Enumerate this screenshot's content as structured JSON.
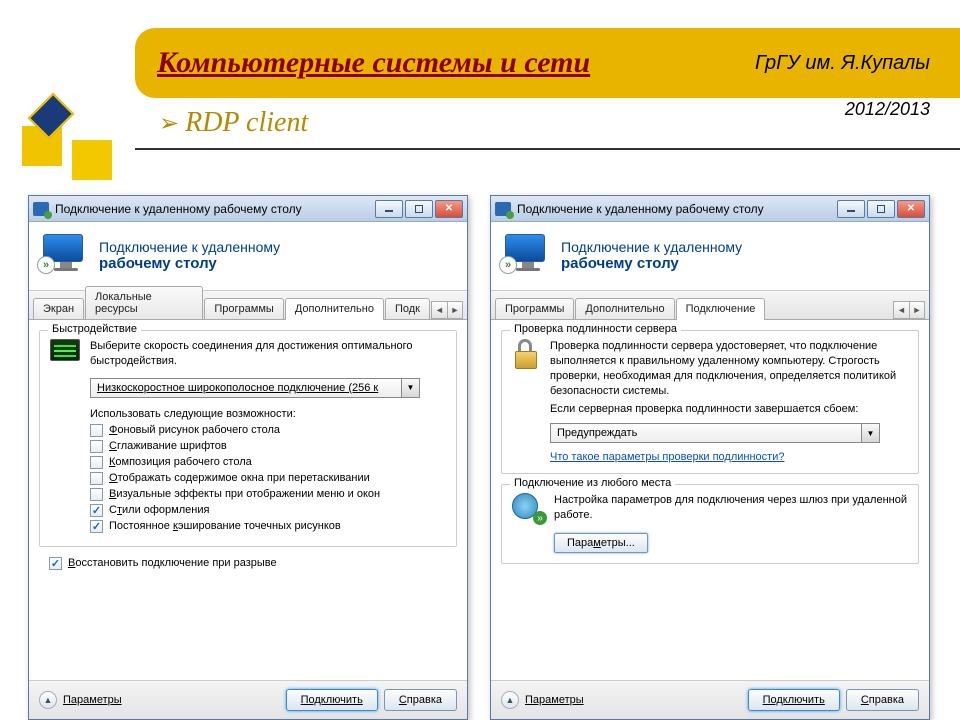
{
  "slide": {
    "title": "Компьютерные системы и сети",
    "subtitle": "RDP client",
    "university": "ГрГУ им. Я.Купалы",
    "year": "2012/2013"
  },
  "window": {
    "title": "Подключение к удаленному рабочему столу",
    "header_line1": "Подключение к удаленному",
    "header_line2": "рабочему столу"
  },
  "left": {
    "tabs": [
      "Экран",
      "Локальные ресурсы",
      "Программы",
      "Дополнительно",
      "Подк"
    ],
    "active_tab": 3,
    "group_perf": {
      "label": "Быстродействие",
      "desc": "Выберите скорость соединения для достижения оптимального быстродействия.",
      "speed_value": "Низкоскоростное широкополосное подключение (256 к",
      "sublabel": "Использовать следующие возможности:",
      "checks": [
        {
          "label": "Фоновый рисунок рабочего стола",
          "checked": false
        },
        {
          "label": "Сглаживание шрифтов",
          "checked": false
        },
        {
          "label": "Композиция рабочего стола",
          "checked": false
        },
        {
          "label": "Отображать содержимое окна при перетаскивании",
          "checked": false
        },
        {
          "label": "Визуальные эффекты при отображении меню и окон",
          "checked": false
        },
        {
          "label": "Стили оформления",
          "checked": true
        },
        {
          "label": "Постоянное кэширование точечных рисунков",
          "checked": true
        }
      ]
    },
    "reconnect": {
      "label": "Восстановить подключение при разрыве",
      "checked": true
    }
  },
  "right": {
    "tabs": [
      "Программы",
      "Дополнительно",
      "Подключение"
    ],
    "active_tab": 2,
    "group_auth": {
      "label": "Проверка подлинности сервера",
      "desc": "Проверка подлинности сервера удостоверяет, что подключение выполняется к правильному удаленному компьютеру. Строгость проверки, необходимая для подключения, определяется политикой безопасности системы.",
      "fail_label": "Если серверная проверка подлинности завершается сбоем:",
      "dropdown_value": "Предупреждать",
      "link": "Что такое параметры проверки подлинности?"
    },
    "group_gateway": {
      "label": "Подключение из любого места",
      "desc": "Настройка параметров для подключения через шлюз при удаленной работе.",
      "button": "Параметры..."
    }
  },
  "footer": {
    "params": "Параметры",
    "connect": "Подключить",
    "help": "Справка"
  }
}
